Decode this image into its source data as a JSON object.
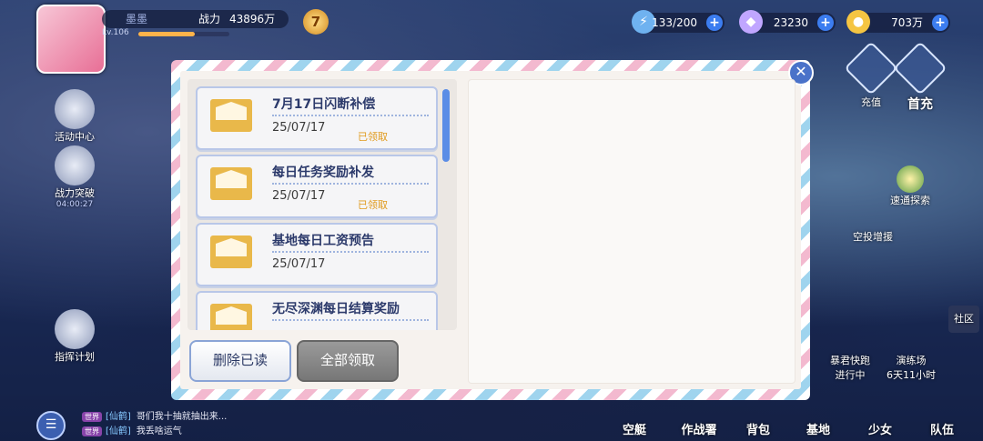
{
  "player": {
    "name": "墨墨",
    "power_label": "战力",
    "power_value": "43896万",
    "level": "Lv.106",
    "exp_fraction": 0.62,
    "vip": "7"
  },
  "resources": [
    {
      "icon": "stamina-icon",
      "value": "133/200"
    },
    {
      "icon": "diamond-icon",
      "value": "23230"
    },
    {
      "icon": "gold-coin-icon",
      "value": "703万"
    }
  ],
  "left_menu": [
    {
      "label": "活动中心",
      "sub": ""
    },
    {
      "label": "战力突破",
      "sub": "04:00:27"
    },
    {
      "label": "指挥计划",
      "sub": ""
    }
  ],
  "right_menu": [
    {
      "label": "充值"
    },
    {
      "label": "首充"
    },
    {
      "label": "速通探索"
    },
    {
      "label": "空投增援"
    },
    {
      "label": "社区"
    }
  ],
  "events": [
    {
      "label": "暴君快跑",
      "status": "进行中"
    },
    {
      "label": "演练场",
      "status": "6天11小时"
    }
  ],
  "chat": [
    {
      "tag": "世界",
      "who": "[仙鹤]",
      "text": "哥们我十抽就抽出来..."
    },
    {
      "tag": "世界",
      "who": "[仙鹤]",
      "text": "我丢啥运气"
    }
  ],
  "bottom_nav": [
    "空艇",
    "作战署",
    "背包",
    "基地",
    "少女",
    "队伍"
  ],
  "mailbox": {
    "mails": [
      {
        "title": "7月17日闪断补偿",
        "date": "25/07/17",
        "status": "已领取"
      },
      {
        "title": "每日任务奖励补发",
        "date": "25/07/17",
        "status": "已领取"
      },
      {
        "title": "基地每日工资预告",
        "date": "25/07/17",
        "status": ""
      },
      {
        "title": "无尽深渊每日结算奖励",
        "date": "",
        "status": ""
      }
    ],
    "delete_read_label": "删除已读",
    "claim_all_label": "全部领取",
    "close_symbol": "✕"
  }
}
